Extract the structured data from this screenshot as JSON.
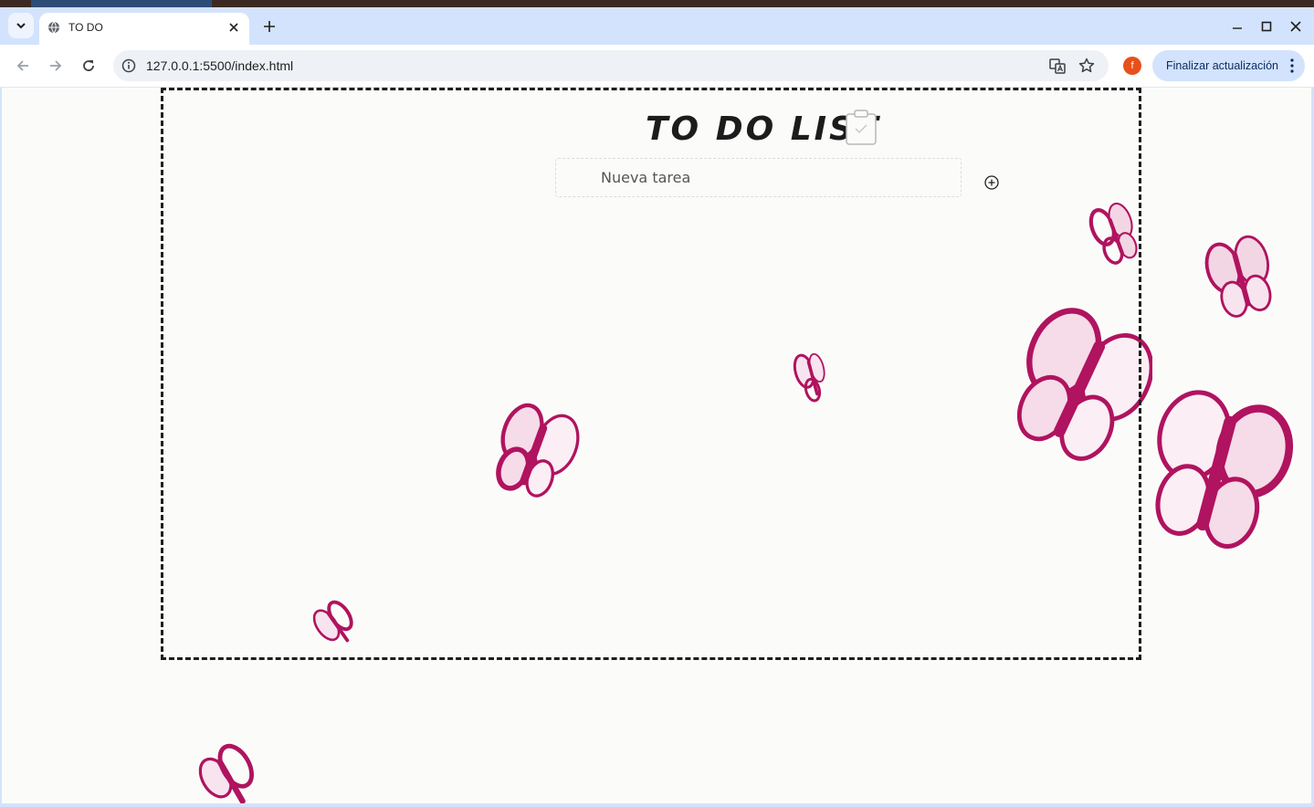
{
  "browser": {
    "tab": {
      "title": "TO DO",
      "icon": "globe-icon"
    },
    "address": {
      "url": "127.0.0.1:5500/index.html"
    },
    "profile_initial": "f",
    "update_label": "Finalizar actualización"
  },
  "page": {
    "title": "TO DO LIST",
    "title_icon": "clipboard-check-icon",
    "input_placeholder": "Nueva tarea",
    "add_icon": "add-circle-icon",
    "decoration_icon": "butterfly-icon"
  },
  "colors": {
    "accent_butterfly": "#b0135f",
    "tab_strip": "#d3e3fd",
    "profile": "#e8501a"
  }
}
